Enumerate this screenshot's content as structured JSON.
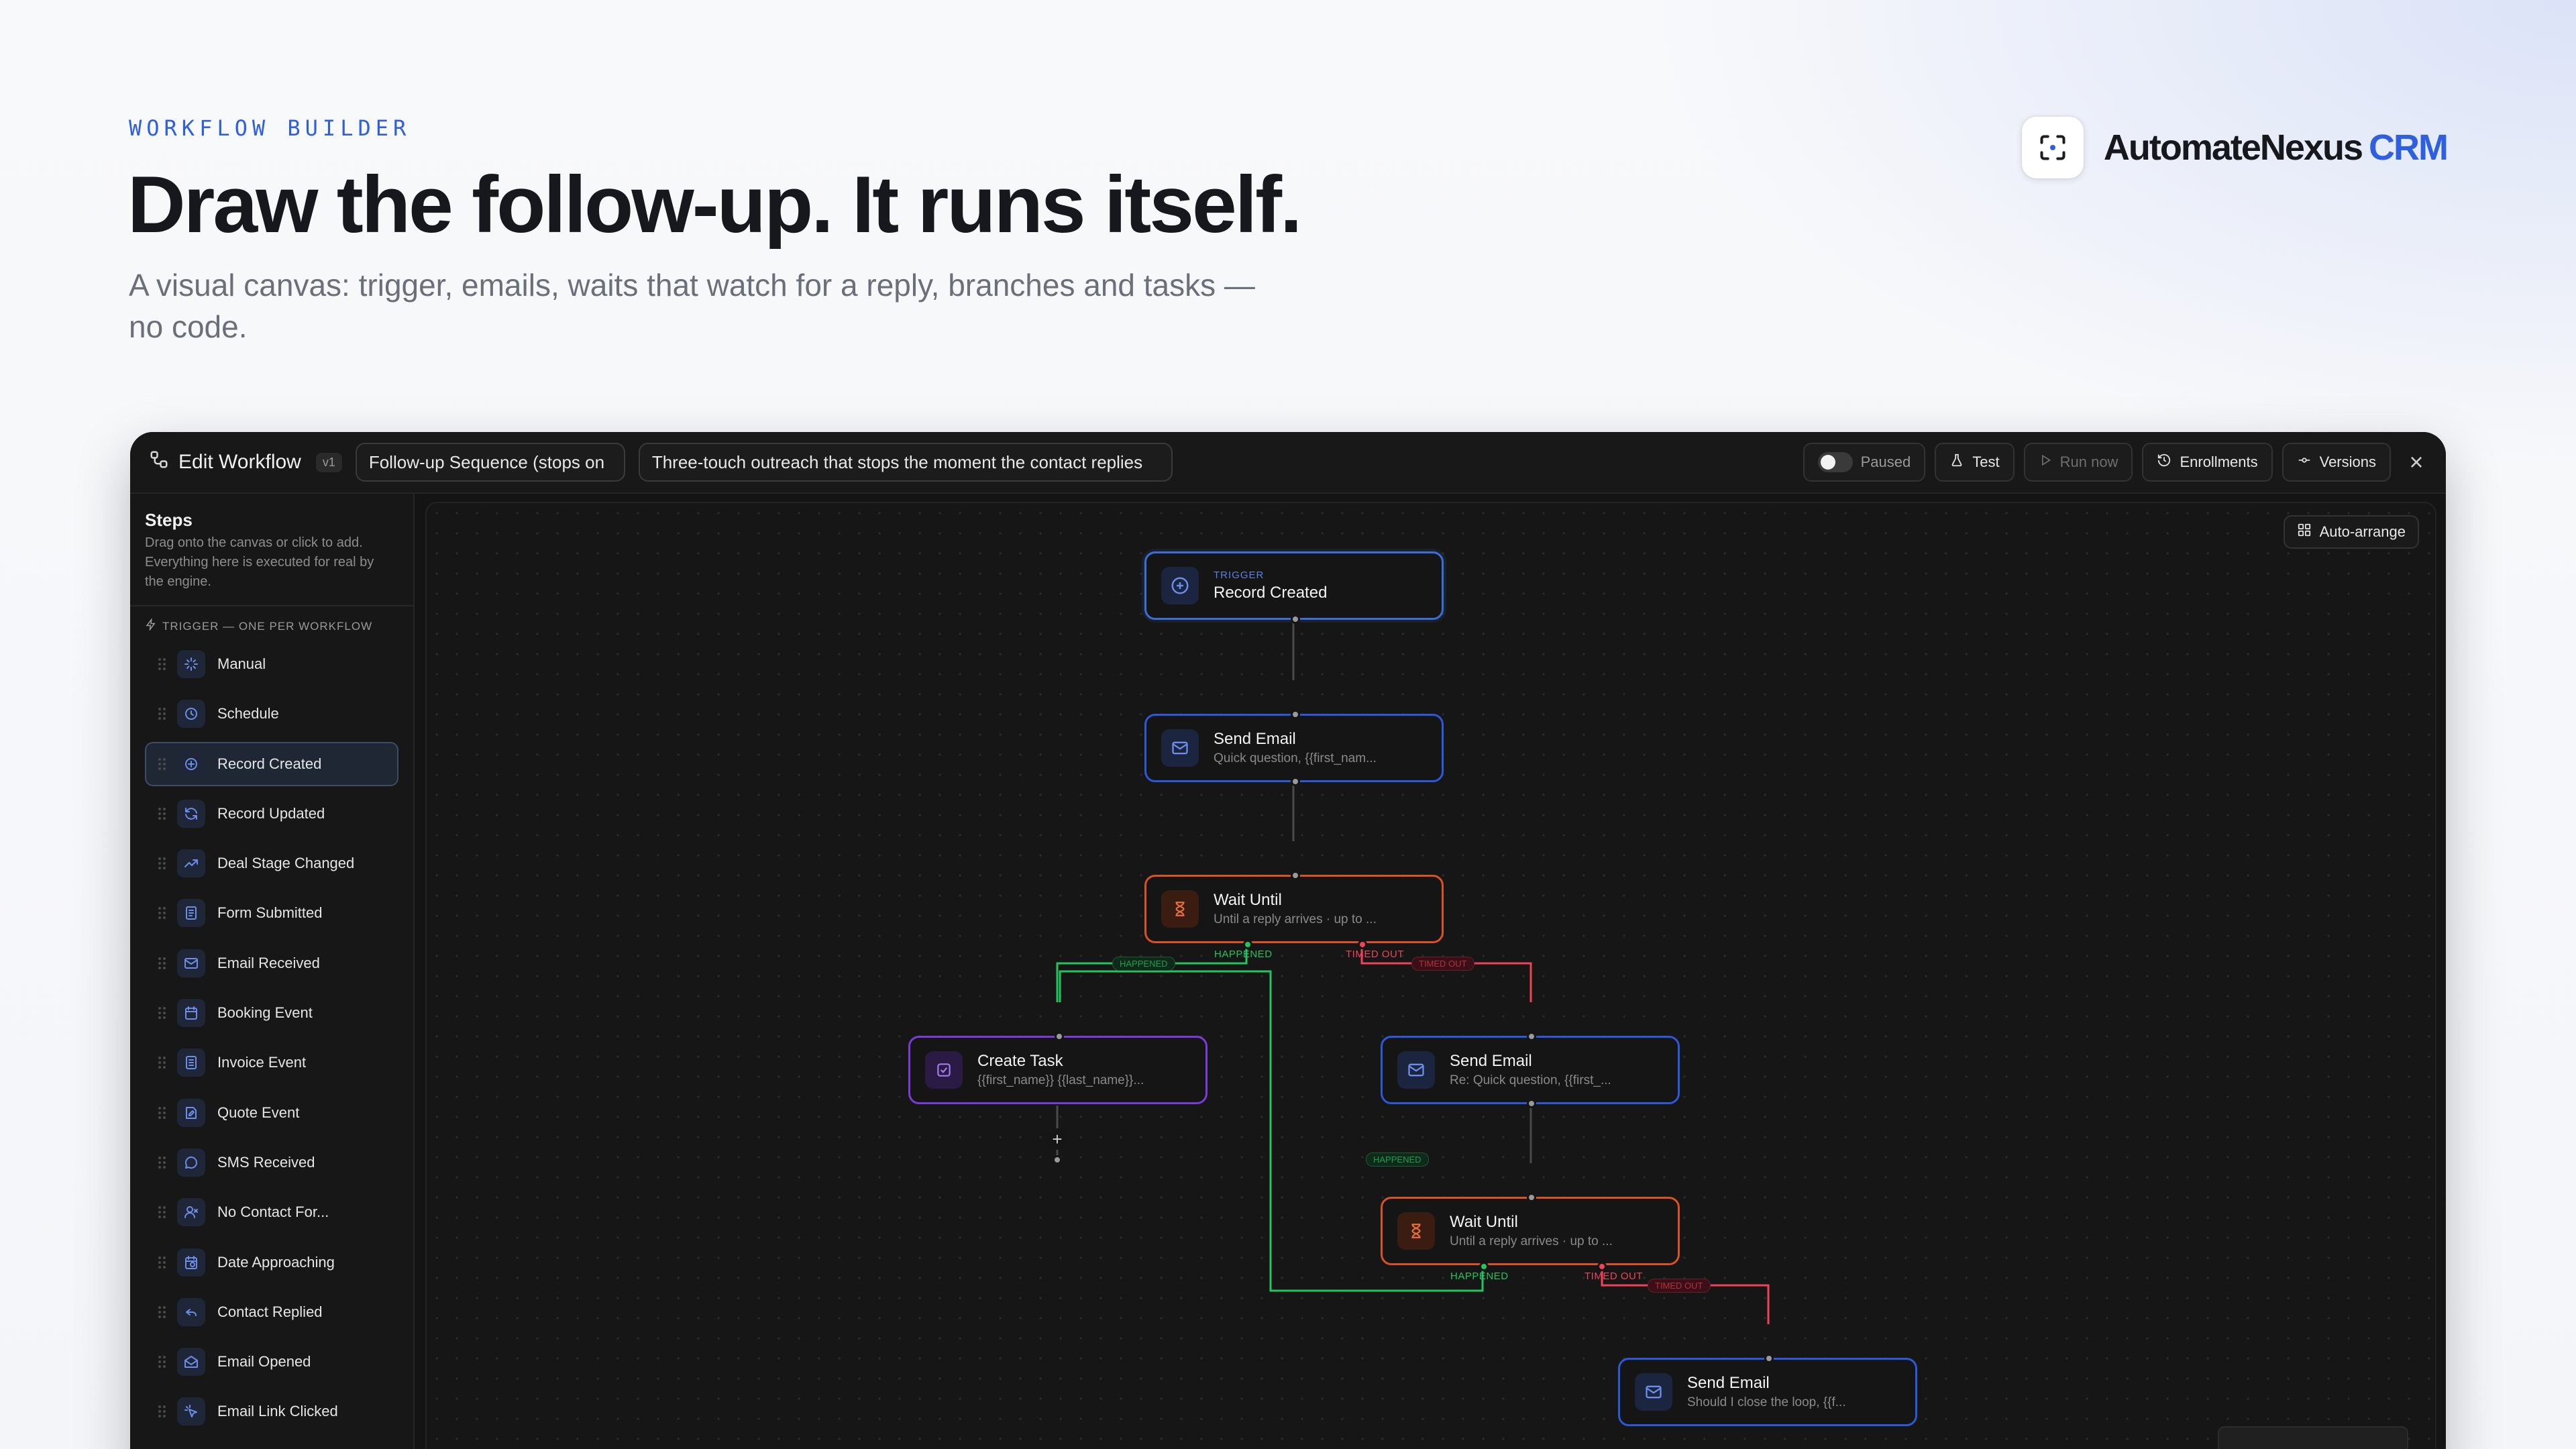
{
  "hero": {
    "eyebrow": "WORKFLOW BUILDER",
    "headline": "Draw the follow-up. It runs itself.",
    "subhead": "A visual canvas: trigger, emails, waits that watch for a reply, branches and tasks — no code."
  },
  "brand": {
    "name": "AutomateNexus",
    "accent": "CRM",
    "logo_icon": "focus-frame-icon"
  },
  "topbar": {
    "title": "Edit Workflow",
    "version": "v1",
    "name_value": "Follow-up Sequence (stops on",
    "description_value": "Three-touch outreach that stops the moment the contact replies",
    "status_label": "Paused",
    "test_label": "Test",
    "run_now_label": "Run now",
    "enrollments_label": "Enrollments",
    "versions_label": "Versions",
    "close_symbol": "×"
  },
  "sidebar": {
    "title": "Steps",
    "description": "Drag onto the canvas or click to add. Everything here is executed for real by the engine.",
    "section_label": "TRIGGER — ONE PER WORKFLOW",
    "items": [
      {
        "label": "Manual",
        "icon": "sparkle-icon"
      },
      {
        "label": "Schedule",
        "icon": "clock-icon"
      },
      {
        "label": "Record Created",
        "icon": "plus-circle-icon",
        "active": true
      },
      {
        "label": "Record Updated",
        "icon": "refresh-icon"
      },
      {
        "label": "Deal Stage Changed",
        "icon": "trending-up-icon"
      },
      {
        "label": "Form Submitted",
        "icon": "form-icon"
      },
      {
        "label": "Email Received",
        "icon": "mail-icon"
      },
      {
        "label": "Booking Event",
        "icon": "calendar-icon"
      },
      {
        "label": "Invoice Event",
        "icon": "invoice-icon"
      },
      {
        "label": "Quote Event",
        "icon": "quote-icon"
      },
      {
        "label": "SMS Received",
        "icon": "chat-icon"
      },
      {
        "label": "No Contact For...",
        "icon": "user-x-icon"
      },
      {
        "label": "Date Approaching",
        "icon": "calendar-clock-icon"
      },
      {
        "label": "Contact Replied",
        "icon": "reply-icon"
      },
      {
        "label": "Email Opened",
        "icon": "mail-open-icon"
      },
      {
        "label": "Email Link Clicked",
        "icon": "click-icon"
      }
    ]
  },
  "canvas": {
    "auto_arrange_label": "Auto-arrange",
    "add_symbol": "+",
    "nodes": {
      "trigger": {
        "kicker": "TRIGGER",
        "title": "Record Created"
      },
      "email1": {
        "title": "Send Email",
        "sub": "Quick question, {{first_nam..."
      },
      "wait1": {
        "title": "Wait Until",
        "sub": "Until a reply arrives · up to ..."
      },
      "task": {
        "title": "Create Task",
        "sub": "{{first_name}} {{last_name}}..."
      },
      "email2": {
        "title": "Send Email",
        "sub": "Re: Quick question, {{first_..."
      },
      "wait2": {
        "title": "Wait Until",
        "sub": "Until a reply arrives · up to ..."
      },
      "email3": {
        "title": "Send Email",
        "sub": "Should I close the loop, {{f..."
      }
    },
    "branch_labels": {
      "happened": "HAPPENED",
      "timed_out": "TIMED OUT"
    }
  },
  "colors": {
    "accent": "#2d5fe0",
    "email_border": "#2a5ad9",
    "wait_border": "#d9531e",
    "task_border": "#7c3ad9",
    "happened": "#22c55e",
    "timed_out": "#f0435a"
  }
}
